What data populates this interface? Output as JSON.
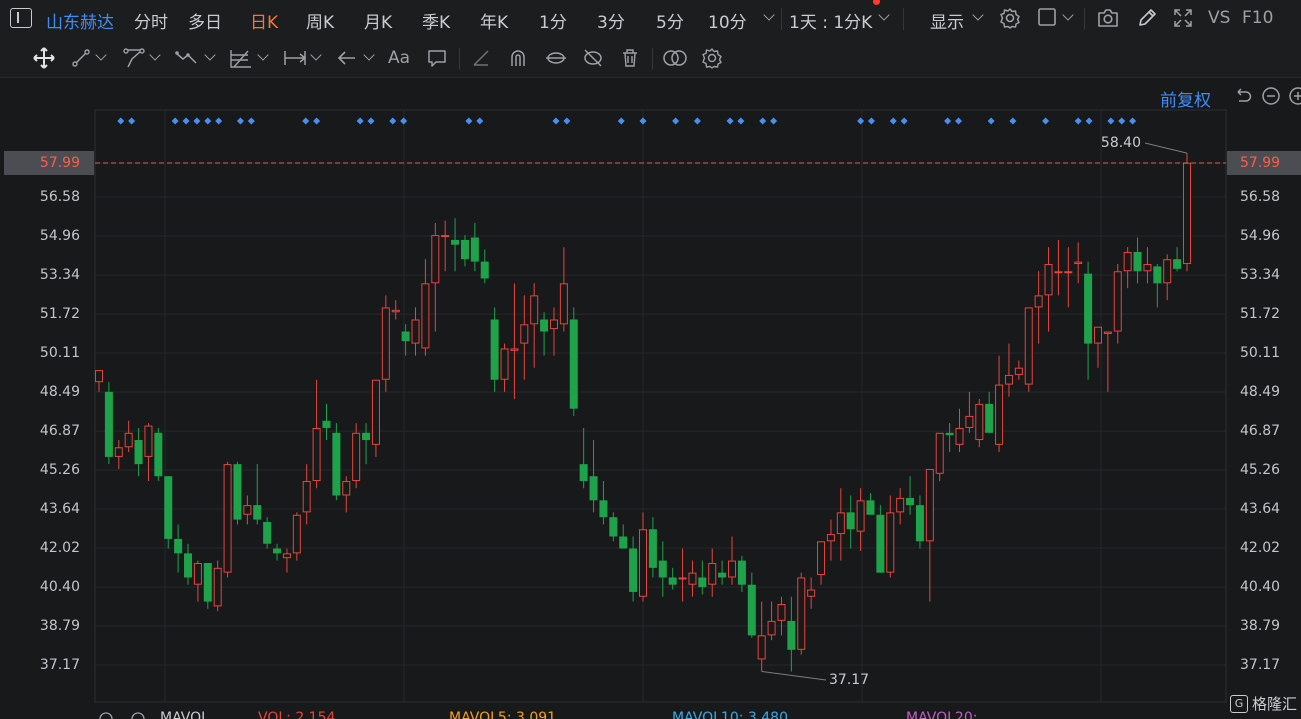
{
  "stock": {
    "name": "山东赫达"
  },
  "periods": [
    {
      "label": "分时",
      "active": false
    },
    {
      "label": "多日",
      "active": false
    },
    {
      "label": "日K",
      "active": true
    },
    {
      "label": "周K",
      "active": false
    },
    {
      "label": "月K",
      "active": false
    },
    {
      "label": "季K",
      "active": false
    },
    {
      "label": "年K",
      "active": false
    },
    {
      "label": "1分",
      "active": false
    },
    {
      "label": "3分",
      "active": false
    },
    {
      "label": "5分",
      "active": false
    },
    {
      "label": "10分",
      "active": false
    }
  ],
  "interval_select": "1天 : 1分K",
  "display_menu": "显示",
  "vs_label": "VS",
  "f10_label": "F10",
  "font_tool_label": "Aa",
  "adjust_label": "前复权",
  "watermark": "格隆汇",
  "colors": {
    "up": "#e5463c",
    "down": "#1fa34a",
    "accent": "#3f8ef5",
    "active_period": "#f5743a",
    "price_line": "#e0613e"
  },
  "indicators": {
    "mavol": "MAVOL",
    "vol": "VOL: 2.154",
    "mavol5": "MAVOL5: 3.091",
    "mavol10": "MAVOL10: 3.480",
    "mavol20": "MAVOL20:"
  },
  "chart_data": {
    "type": "candlestick",
    "y_ticks": [
      "57.99",
      "56.58",
      "54.96",
      "53.34",
      "51.72",
      "50.11",
      "48.49",
      "46.87",
      "45.26",
      "43.64",
      "42.02",
      "40.40",
      "38.79",
      "37.17"
    ],
    "ylim": [
      36.5,
      59.5
    ],
    "current_price": "57.99",
    "max_label": "58.40",
    "min_label": "37.17",
    "candles": [
      [
        48.9,
        49.4,
        48.5,
        49.4
      ],
      [
        48.5,
        48.9,
        45.5,
        45.8
      ],
      [
        45.8,
        46.5,
        45.3,
        46.2
      ],
      [
        46.2,
        47.3,
        46.0,
        46.8
      ],
      [
        46.5,
        47.0,
        45.0,
        45.5
      ],
      [
        45.8,
        47.2,
        44.8,
        47.1
      ],
      [
        46.8,
        47.0,
        44.8,
        45.0
      ],
      [
        45.0,
        45.0,
        42.0,
        42.4
      ],
      [
        42.4,
        43.0,
        41.0,
        41.8
      ],
      [
        41.8,
        42.2,
        40.5,
        40.8
      ],
      [
        40.5,
        41.5,
        39.8,
        41.4
      ],
      [
        41.4,
        41.4,
        39.5,
        39.8
      ],
      [
        39.6,
        41.5,
        39.4,
        41.2
      ],
      [
        41.0,
        45.6,
        40.8,
        45.5
      ],
      [
        45.5,
        45.6,
        43.0,
        43.2
      ],
      [
        43.4,
        44.2,
        43.0,
        43.8
      ],
      [
        43.8,
        45.5,
        43.0,
        43.2
      ],
      [
        43.1,
        43.3,
        42.0,
        42.2
      ],
      [
        42.0,
        42.2,
        41.5,
        41.8
      ],
      [
        41.6,
        42.0,
        41.0,
        41.8
      ],
      [
        41.8,
        43.5,
        41.5,
        43.4
      ],
      [
        43.5,
        45.5,
        43.0,
        44.8
      ],
      [
        44.8,
        49.0,
        44.5,
        47.0
      ],
      [
        47.3,
        48.0,
        46.5,
        47.0
      ],
      [
        46.8,
        47.2,
        44.0,
        44.2
      ],
      [
        44.2,
        45.0,
        43.5,
        44.8
      ],
      [
        44.8,
        47.2,
        44.5,
        46.8
      ],
      [
        46.8,
        47.2,
        45.5,
        46.5
      ],
      [
        46.3,
        49.0,
        45.8,
        49.0
      ],
      [
        49.0,
        52.5,
        48.5,
        52.0
      ],
      [
        51.8,
        52.3,
        51.5,
        51.9
      ],
      [
        51.0,
        51.3,
        50.0,
        50.6
      ],
      [
        50.5,
        52.0,
        50.0,
        51.5
      ],
      [
        50.3,
        54.0,
        50.0,
        53.0
      ],
      [
        53.0,
        55.5,
        51.0,
        55.0
      ],
      [
        55.0,
        55.6,
        53.5,
        55.0
      ],
      [
        54.8,
        55.7,
        53.5,
        54.6
      ],
      [
        54.8,
        55.0,
        53.7,
        54.0
      ],
      [
        54.9,
        55.5,
        53.5,
        53.9
      ],
      [
        53.9,
        54.4,
        53.0,
        53.2
      ],
      [
        51.5,
        52.0,
        48.5,
        49.0
      ],
      [
        49.0,
        50.5,
        48.5,
        50.3
      ],
      [
        50.2,
        53.0,
        48.2,
        50.3
      ],
      [
        50.5,
        52.5,
        49.0,
        51.3
      ],
      [
        51.3,
        53.0,
        49.5,
        52.5
      ],
      [
        51.5,
        51.8,
        50.0,
        51.0
      ],
      [
        51.1,
        52.0,
        50.0,
        51.5
      ],
      [
        51.3,
        54.5,
        51.0,
        53.0
      ],
      [
        51.5,
        52.0,
        47.5,
        47.8
      ],
      [
        45.5,
        47.0,
        44.5,
        44.8
      ],
      [
        45.0,
        46.5,
        43.5,
        44.0
      ],
      [
        44.0,
        44.8,
        43.0,
        43.3
      ],
      [
        43.3,
        43.5,
        42.3,
        42.5
      ],
      [
        42.5,
        43.0,
        42.0,
        42.0
      ],
      [
        42.0,
        42.5,
        39.8,
        40.2
      ],
      [
        40.0,
        43.5,
        39.8,
        42.8
      ],
      [
        42.8,
        43.3,
        40.8,
        41.2
      ],
      [
        41.5,
        42.3,
        40.0,
        40.8
      ],
      [
        40.8,
        41.2,
        40.3,
        40.5
      ],
      [
        40.8,
        42.0,
        39.8,
        40.8
      ],
      [
        40.5,
        41.5,
        40.0,
        41.0
      ],
      [
        40.8,
        41.5,
        40.1,
        40.4
      ],
      [
        40.5,
        42.0,
        40.0,
        41.4
      ],
      [
        41.0,
        41.5,
        40.5,
        40.8
      ],
      [
        40.8,
        42.5,
        40.5,
        41.5
      ],
      [
        41.5,
        41.7,
        40.2,
        40.5
      ],
      [
        40.5,
        41.0,
        38.3,
        38.4
      ],
      [
        37.4,
        39.8,
        36.9,
        38.4
      ],
      [
        38.4,
        39.8,
        38.2,
        39.0
      ],
      [
        39.0,
        40.0,
        38.4,
        39.7
      ],
      [
        39.0,
        40.0,
        36.9,
        37.8
      ],
      [
        37.8,
        41.0,
        37.6,
        40.8
      ],
      [
        40.0,
        40.8,
        39.5,
        40.3
      ],
      [
        40.9,
        41.2,
        40.5,
        42.3
      ],
      [
        42.3,
        43.2,
        41.5,
        42.6
      ],
      [
        42.6,
        44.5,
        41.5,
        43.5
      ],
      [
        43.5,
        44.2,
        42.0,
        42.8
      ],
      [
        42.7,
        44.5,
        41.9,
        44.0
      ],
      [
        44.0,
        44.3,
        43.5,
        43.4
      ],
      [
        43.4,
        43.8,
        41.0,
        41.0
      ],
      [
        41.0,
        44.2,
        40.8,
        43.5
      ],
      [
        43.5,
        44.5,
        43.0,
        44.1
      ],
      [
        44.1,
        45.0,
        43.4,
        43.8
      ],
      [
        43.8,
        44.2,
        42.0,
        42.3
      ],
      [
        42.3,
        45.3,
        39.8,
        45.3
      ],
      [
        45.1,
        46.2,
        44.8,
        46.8
      ],
      [
        46.8,
        47.2,
        46.0,
        46.7
      ],
      [
        46.3,
        47.8,
        46.0,
        47.0
      ],
      [
        47.0,
        48.5,
        46.8,
        47.5
      ],
      [
        46.5,
        48.2,
        46.2,
        48.0
      ],
      [
        48.0,
        48.5,
        46.8,
        46.8
      ],
      [
        46.3,
        50.0,
        46.0,
        48.8
      ],
      [
        48.8,
        50.5,
        48.3,
        49.2
      ],
      [
        49.2,
        49.8,
        49.0,
        49.5
      ],
      [
        48.8,
        51.5,
        48.5,
        52.0
      ],
      [
        52.0,
        53.5,
        50.5,
        52.5
      ],
      [
        52.5,
        54.5,
        51.0,
        53.8
      ],
      [
        53.5,
        54.8,
        52.5,
        53.5
      ],
      [
        53.5,
        54.5,
        52.0,
        53.5
      ],
      [
        53.8,
        54.7,
        53.0,
        53.9
      ],
      [
        53.4,
        53.9,
        49.0,
        50.5
      ],
      [
        50.5,
        51.0,
        49.5,
        51.2
      ],
      [
        50.9,
        51.0,
        48.5,
        51.0
      ],
      [
        51.0,
        53.8,
        50.5,
        53.5
      ],
      [
        53.5,
        54.5,
        52.8,
        54.3
      ],
      [
        54.3,
        54.9,
        53.0,
        53.5
      ],
      [
        53.5,
        54.5,
        53.0,
        53.8
      ],
      [
        53.7,
        53.8,
        52.0,
        53.0
      ],
      [
        53.0,
        54.2,
        52.3,
        54.0
      ],
      [
        54.0,
        54.5,
        53.5,
        53.6
      ],
      [
        53.8,
        58.4,
        53.5,
        58.0
      ]
    ],
    "signal_markers": [
      2,
      3,
      7,
      8,
      9,
      10,
      11,
      13,
      14,
      19,
      20,
      24,
      25,
      27,
      28,
      34,
      35,
      42,
      43,
      48,
      50,
      53,
      55,
      58,
      59,
      61,
      62,
      70,
      71,
      73,
      74,
      78,
      79,
      82,
      84,
      87,
      90,
      91,
      93,
      94,
      95
    ]
  }
}
